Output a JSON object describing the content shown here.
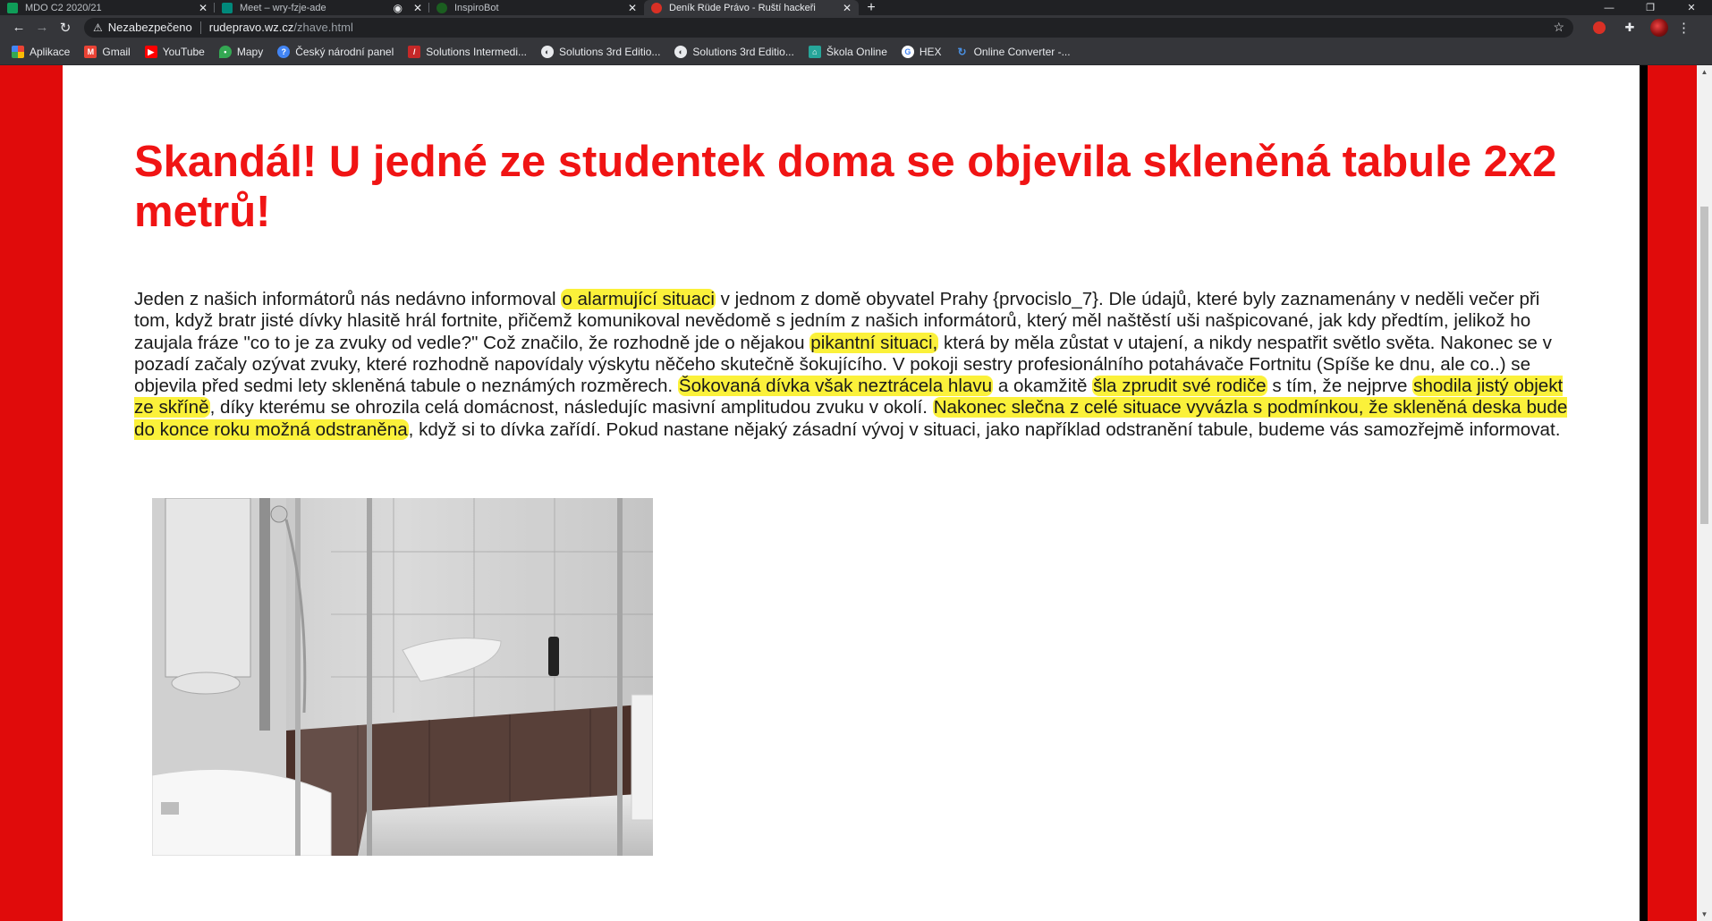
{
  "browser": {
    "tabs": [
      {
        "title": "MDO C2 2020/21",
        "close": "✕",
        "active": false,
        "favicon_color": "#0f9d58"
      },
      {
        "title": "Meet – wry-fzje-ade",
        "close": "✕",
        "active": false,
        "favicon_color": "#00897b"
      },
      {
        "title": "InspiroBot",
        "close": "✕",
        "active": false,
        "favicon_color": "#33aa33"
      },
      {
        "title": "Deník Rüde Právo - Ruští hackeři",
        "close": "✕",
        "active": true,
        "favicon_color": "#d93025"
      }
    ],
    "new_tab": "+",
    "window_controls": {
      "minimize": "—",
      "restore": "❐",
      "close": "✕"
    },
    "nav": {
      "back": "←",
      "forward": "→",
      "reload": "↻"
    },
    "address": {
      "warning_icon": "⚠",
      "security_label": "Nezabezpečeno",
      "host": "rudepravo.wz.cz",
      "path": "/zhave.html",
      "bookmark_star": "☆"
    },
    "extensions": {
      "puzzle": "✚",
      "menu": "⋮"
    },
    "bookmarks": [
      {
        "label": "Aplikace",
        "icon": "apps-grid-icon",
        "color": "#ea4335"
      },
      {
        "label": "Gmail",
        "icon": "gmail-icon",
        "color": "#ea4335"
      },
      {
        "label": "YouTube",
        "icon": "youtube-icon",
        "color": "#ff0000"
      },
      {
        "label": "Mapy",
        "icon": "maps-pin-icon",
        "color": "#34a853"
      },
      {
        "label": "Český národní panel",
        "icon": "panel-icon",
        "color": "#4285f4"
      },
      {
        "label": "Solutions Intermedi...",
        "icon": "oxford-icon",
        "color": "#c62828"
      },
      {
        "label": "Solutions 3rd Editio...",
        "icon": "globe-icon",
        "color": "#e8eaed"
      },
      {
        "label": "Solutions 3rd Editio...",
        "icon": "globe-icon",
        "color": "#e8eaed"
      },
      {
        "label": "Škola Online",
        "icon": "skola-online-icon",
        "color": "#26a69a"
      },
      {
        "label": "HEX",
        "icon": "google-icon",
        "color": "#ffffff"
      },
      {
        "label": "Online Converter -...",
        "icon": "converter-icon",
        "color": "#4a90e2"
      }
    ]
  },
  "page": {
    "background": "#e00b0b",
    "headline_color": "#f01414",
    "highlight_color": "#fbf13a",
    "headline": "Skandál! U jedné ze studentek doma se objevila skleněná tabule 2x2 metrů!",
    "article": {
      "segments": [
        {
          "text": "Jeden z našich informátorů nás nedávno informoval ",
          "hl": false
        },
        {
          "text": "o alarmující situaci",
          "hl": true
        },
        {
          "text": " v jednom z domě obyvatel Prahy {prvocislo_7}. Dle údajů, které byly zaznamenány v neděli večer při tom, když bratr jisté dívky hlasitě hrál fortnite, přičemž komunikoval nevědomě s jedním z našich informátorů, který měl naštěstí uši našpicované, jak kdy předtím, jelikož ho zaujala fráze \"co to je za zvuky od vedle?\" Což značilo, že rozhodně jde o nějakou ",
          "hl": false
        },
        {
          "text": "pikantní situaci,",
          "hl": true
        },
        {
          "text": " která by měla zůstat v utajení, a nikdy nespatřit světlo světa. Nakonec se v pozadí začaly ozývat zvuky, které rozhodně napovídaly výskytu něčeho skutečně šokujícího. V pokoji sestry profesionálního potahávače Fortnitu (Spíše ke dnu, ale co..) se objevila před sedmi lety skleněná tabule o neznámých rozměrech. ",
          "hl": false
        },
        {
          "text": "Šokovaná dívka však neztrácela hlavu",
          "hl": true
        },
        {
          "text": " a okamžitě ",
          "hl": false
        },
        {
          "text": "šla zprudit své rodiče",
          "hl": true
        },
        {
          "text": " s tím, že nejprve ",
          "hl": false
        },
        {
          "text": "shodila jistý objekt ze skříně",
          "hl": true
        },
        {
          "text": ", díky kterému se ohrozila celá domácnost, následujíc masivní amplitudou zvuku v okolí. ",
          "hl": false
        },
        {
          "text": "Nakonec slečna z celé situace vyvázla s podmínkou, že skleněná deska bude do konce roku možná odstraněna",
          "hl": true
        },
        {
          "text": ", když si to dívka zařídí. Pokud nastane nějaký zásadní vývoj v situaci, jako například odstranění tabule, budeme vás samozřejmě informovat.",
          "hl": false
        }
      ]
    },
    "photo": {
      "subject": "glass-shower-enclosure-photo"
    }
  }
}
